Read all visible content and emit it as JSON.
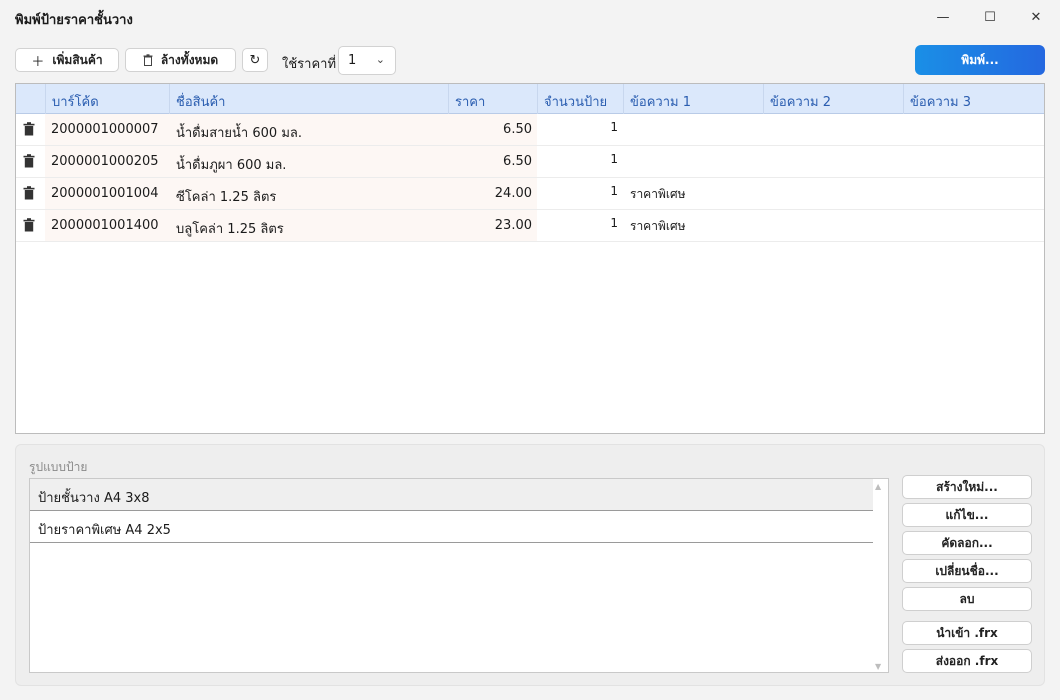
{
  "window": {
    "title": "พิมพ์ป้ายราคาชั้นวาง",
    "minimize_glyph": "—",
    "maximize_glyph": "☐",
    "close_glyph": "✕"
  },
  "toolbar": {
    "add_icon": "plus-icon",
    "add_label": "เพิ่มสินค้า",
    "clear_icon": "trash-icon",
    "clear_label": "ล้างทั้งหมด",
    "refresh_icon": "refresh-icon",
    "price_label": "ใช้ราคาที่",
    "price_selected": "1",
    "print_label": "พิมพ์..."
  },
  "grid": {
    "columns": [
      "บาร์โค้ด",
      "ชื่อสินค้า",
      "ราคา",
      "จำนวนป้าย",
      "ข้อความ 1",
      "ข้อความ 2",
      "ข้อความ 3"
    ],
    "rows": [
      {
        "barcode": "2000001000007",
        "name": "น้ำดื่มสายน้ำ 600 มล.",
        "price": "6.50",
        "qty": "1",
        "text1": "",
        "text2": "",
        "text3": ""
      },
      {
        "barcode": "2000001000205",
        "name": "น้ำดื่มภูผา 600 มล.",
        "price": "6.50",
        "qty": "1",
        "text1": "",
        "text2": "",
        "text3": ""
      },
      {
        "barcode": "2000001001004",
        "name": "ซีโคล่า 1.25 ลิตร",
        "price": "24.00",
        "qty": "1",
        "text1": "ราคาพิเศษ",
        "text2": "",
        "text3": ""
      },
      {
        "barcode": "2000001001400",
        "name": "บลูโคล่า 1.25 ลิตร",
        "price": "23.00",
        "qty": "1",
        "text1": "ราคาพิเศษ",
        "text2": "",
        "text3": ""
      }
    ]
  },
  "templates": {
    "label": "รูปแบบป้าย",
    "items": [
      "ป้ายชั้นวาง A4 3x8",
      "ป้ายราคาพิเศษ A4 2x5"
    ],
    "selected_index": 0,
    "buttons": {
      "new": "สร้างใหม่...",
      "edit": "แก้ไข...",
      "copy": "คัดลอก...",
      "rename": "เปลี่ยนชื่อ...",
      "delete": "ลบ",
      "import": "นำเข้า .frx",
      "export": "ส่งออก .frx"
    }
  },
  "colors": {
    "accent": "#1f7ae4",
    "header_bg": "#dbe8fb",
    "header_text": "#2a5db0"
  }
}
